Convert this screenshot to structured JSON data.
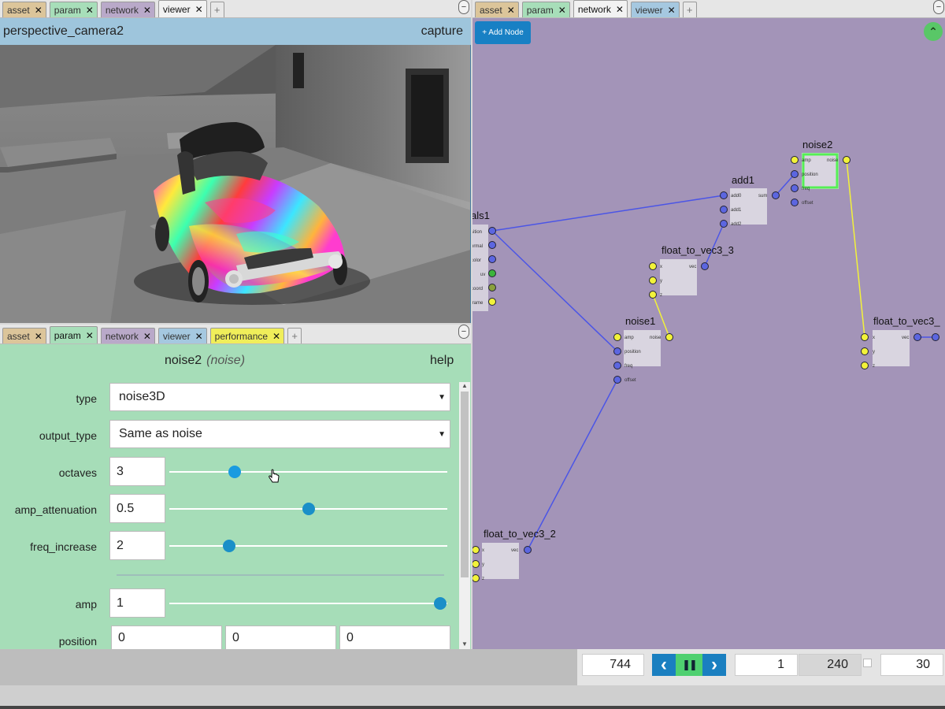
{
  "viewer_pane": {
    "tabs": [
      {
        "label": "asset",
        "kind": "asset"
      },
      {
        "label": "param",
        "kind": "param"
      },
      {
        "label": "network",
        "kind": "network"
      },
      {
        "label": "viewer",
        "kind": "viewer",
        "active": true
      }
    ],
    "minimize": "−",
    "camera_name": "perspective_camera2",
    "capture_label": "capture"
  },
  "param_pane": {
    "tabs": [
      {
        "label": "asset",
        "kind": "asset"
      },
      {
        "label": "param",
        "kind": "param",
        "active": true
      },
      {
        "label": "network",
        "kind": "network"
      },
      {
        "label": "viewer",
        "kind": "viewer"
      },
      {
        "label": "performance",
        "kind": "performance"
      }
    ],
    "minimize": "−",
    "node_name": "noise2",
    "node_type": "(noise)",
    "help_label": "help",
    "type": {
      "label": "type",
      "value": "noise3D"
    },
    "output_type": {
      "label": "output_type",
      "value": "Same as noise"
    },
    "octaves": {
      "label": "octaves",
      "value": "3",
      "slider_fraction": 0.235
    },
    "amp_attenuation": {
      "label": "amp_attenuation",
      "value": "0.5",
      "slider_fraction": 0.5
    },
    "freq_increase": {
      "label": "freq_increase",
      "value": "2",
      "slider_fraction": 0.215
    },
    "amp": {
      "label": "amp",
      "value": "1",
      "slider_fraction": 0.975
    },
    "position": {
      "label": "position",
      "values": [
        "0",
        "0",
        "0"
      ]
    }
  },
  "network_pane": {
    "tabs": [
      {
        "label": "asset",
        "kind": "asset"
      },
      {
        "label": "param",
        "kind": "param"
      },
      {
        "label": "network",
        "kind": "network",
        "active": true
      },
      {
        "label": "viewer",
        "kind": "viewer"
      }
    ],
    "minimize": "−",
    "add_node_label": "+ Add Node",
    "collapse_icon": "⌃",
    "nodes": {
      "globals": {
        "title": "als1",
        "ports": [
          "sition",
          "ormal",
          "color",
          "uv",
          "coord",
          "frame"
        ]
      },
      "add1": {
        "title": "add1",
        "inputs": [
          "add0",
          "add1",
          "add2"
        ],
        "output": "sum"
      },
      "noise2": {
        "title": "noise2",
        "inputs": [
          "amp",
          "position",
          "freq",
          "offset"
        ],
        "output": "noise"
      },
      "fv3_3": {
        "title": "float_to_vec3_3",
        "inputs": [
          "x",
          "y",
          "z"
        ],
        "output": "vec"
      },
      "noise1": {
        "title": "noise1",
        "inputs": [
          "amp",
          "position",
          "freq",
          "offset"
        ],
        "output": "noise"
      },
      "fv3_r": {
        "title": "float_to_vec3_",
        "inputs": [
          "x",
          "y",
          "z"
        ],
        "output": "vec"
      },
      "fv3_2": {
        "title": "float_to_vec3_2",
        "inputs": [
          "x",
          "y",
          "z"
        ],
        "output": "vec"
      }
    },
    "colors": {
      "wire_vec": "#4b55e6",
      "wire_float": "#f2f23a",
      "selected": "#55f055"
    }
  },
  "playback": {
    "current_frame": "744",
    "prev_icon": "‹",
    "pause_icon": "❚❚",
    "next_icon": "›",
    "start_frame": "1",
    "end_frame": "240",
    "fps": "30"
  }
}
